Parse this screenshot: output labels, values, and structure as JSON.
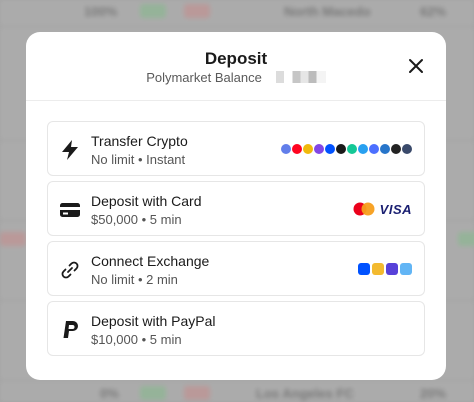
{
  "modal": {
    "title": "Deposit",
    "subtitle": "Polymarket Balance"
  },
  "options": [
    {
      "title": "Transfer Crypto",
      "meta": "No limit • Instant"
    },
    {
      "title": "Deposit with Card",
      "meta": "$50,000 • 5 min",
      "card_text": "VISA"
    },
    {
      "title": "Connect Exchange",
      "meta": "No limit • 2 min"
    },
    {
      "title": "Deposit with PayPal",
      "meta": "$10,000 • 5 min"
    }
  ],
  "background": {
    "top_values": [
      "100%",
      "North Macedo",
      "62%"
    ],
    "bottom_values": [
      "0%",
      "Los Angeles FC",
      "20%"
    ]
  },
  "colors": {
    "modal_bg": "#ffffff",
    "text_primary": "#1a1a1a",
    "text_secondary": "#555555",
    "border": "#e6e6e6",
    "mastercard_red": "#eb001b",
    "mastercard_orange": "#f79e1b",
    "visa_blue": "#1a1f71"
  },
  "icons": {
    "close": "close-icon",
    "transfer": "lightning-icon",
    "card": "credit-card-icon",
    "exchange": "link-icon",
    "paypal": "paypal-icon"
  }
}
